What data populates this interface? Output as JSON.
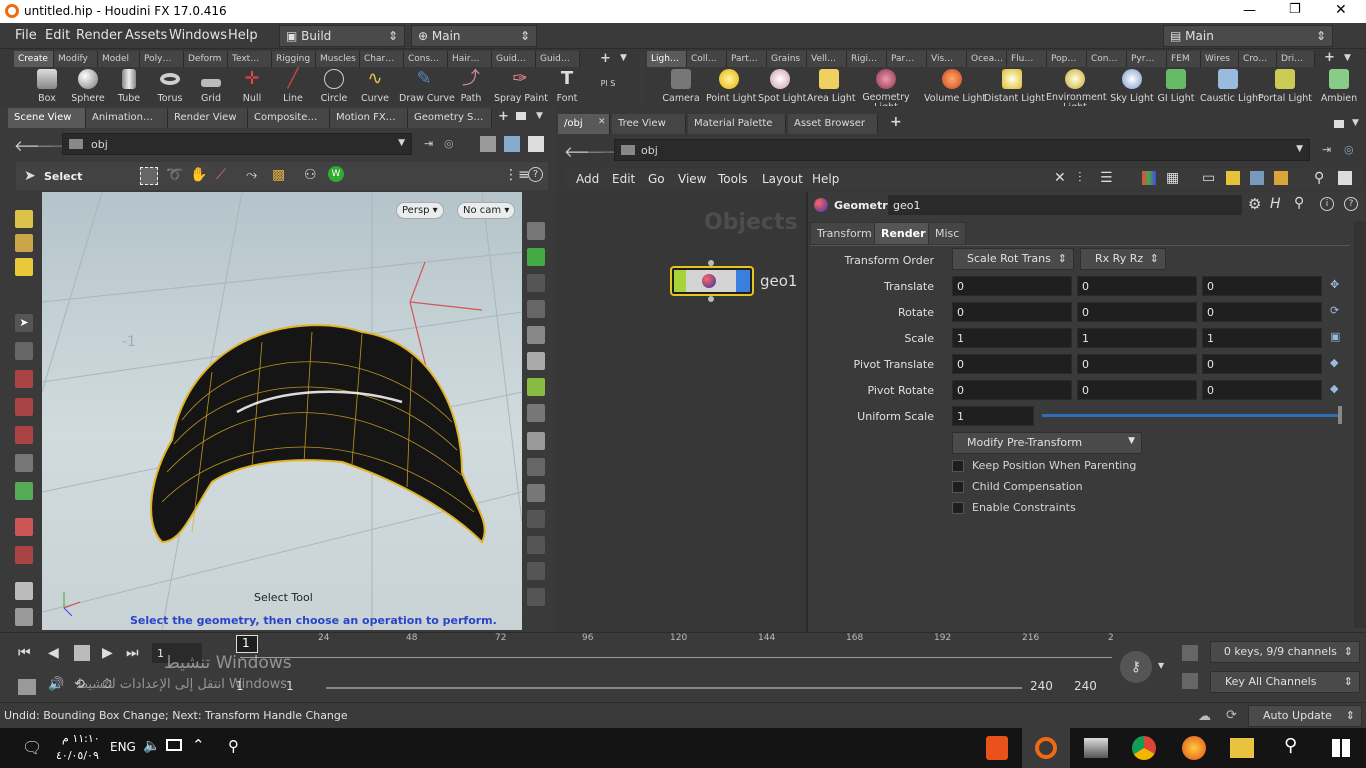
{
  "window": {
    "title": "untitled.hip - Houdini FX 17.0.416",
    "controls": [
      "—",
      "❐",
      "✕"
    ]
  },
  "menubar": {
    "items": [
      "File",
      "Edit",
      "Render",
      "Assets",
      "Windows",
      "Help"
    ],
    "desktop": "Build",
    "context": "Main",
    "right_context": "Main"
  },
  "shelf_left": {
    "tabs": [
      "Create",
      "Modify",
      "Model",
      "Poly…",
      "Deform",
      "Text…",
      "Rigging",
      "Muscles",
      "Char…",
      "Cons…",
      "Hair…",
      "Guid…",
      "Guid…"
    ],
    "tools": [
      "Box",
      "Sphere",
      "Tube",
      "Torus",
      "Grid",
      "Null",
      "Line",
      "Circle",
      "Curve",
      "Draw Curve",
      "Path",
      "Spray Paint",
      "Font",
      "Pl S"
    ]
  },
  "shelf_right": {
    "tabs": [
      "Ligh…",
      "Coll…",
      "Part…",
      "Grains",
      "Vell…",
      "Rigi…",
      "Par…",
      "Vis…",
      "Ocea…",
      "Flu…",
      "Pop…",
      "Con…",
      "Pyr…",
      "FEM",
      "Wires",
      "Cro…",
      "Dri…"
    ],
    "tools": [
      "Camera",
      "Point Light",
      "Spot Light",
      "Area Light",
      "Geometry Light",
      "Volume Light",
      "Distant Light",
      "Environment Light",
      "Sky Light",
      "GI Light",
      "Caustic Light",
      "Portal Light",
      "Ambien"
    ]
  },
  "left_pane": {
    "tabs": [
      "Scene View",
      "Animation…",
      "Render View",
      "Composite…",
      "Motion FX…",
      "Geometry S…"
    ],
    "path": "obj",
    "select_label": "Select",
    "persp": "Persp",
    "cam": "No cam",
    "axis_label": "-1",
    "tool_name": "Select Tool",
    "tool_hint": "Select the geometry, then choose an operation to perform."
  },
  "right_pane": {
    "tabs": [
      "/obj",
      "Tree View",
      "Material Palette",
      "Asset Browser"
    ],
    "path": "obj",
    "menu": [
      "Add",
      "Edit",
      "Go",
      "View",
      "Tools",
      "Layout",
      "Help"
    ],
    "network_label": "Objects",
    "node_name": "geo1"
  },
  "params": {
    "type": "Geometry",
    "name": "geo1",
    "tabs": [
      "Transform",
      "Render",
      "Misc"
    ],
    "transform_order_label": "Transform Order",
    "transform_order": "Scale Rot Trans",
    "rot_order": "Rx Ry Rz",
    "rows": [
      {
        "label": "Translate",
        "v": [
          "0",
          "0",
          "0"
        ]
      },
      {
        "label": "Rotate",
        "v": [
          "0",
          "0",
          "0"
        ]
      },
      {
        "label": "Scale",
        "v": [
          "1",
          "1",
          "1"
        ]
      },
      {
        "label": "Pivot Translate",
        "v": [
          "0",
          "0",
          "0"
        ]
      },
      {
        "label": "Pivot Rotate",
        "v": [
          "0",
          "0",
          "0"
        ]
      }
    ],
    "uniform_scale_label": "Uniform Scale",
    "uniform_scale": "1",
    "modify_pre": "Modify Pre-Transform",
    "checks": [
      "Keep Position When Parenting",
      "Child Compensation",
      "Enable Constraints"
    ]
  },
  "timeline": {
    "current_frame": "1",
    "frame_field": "1",
    "ticks": [
      "24",
      "48",
      "72",
      "96",
      "120",
      "144",
      "168",
      "192",
      "216",
      "2"
    ],
    "range_start": "1",
    "range_start2": "1",
    "range_end": "240",
    "range_end2": "240",
    "keys_info": "0 keys, 9/9 channels",
    "key_all": "Key All Channels",
    "watermark1": "تنشيط Windows",
    "watermark2": "انتقل إلى الإعدادات لتنشيط Windows"
  },
  "status": {
    "text": "Undid: Bounding Box Change; Next: Transform Handle Change",
    "auto_update": "Auto Update"
  },
  "taskbar": {
    "time": "١١:١٠ م",
    "date": "٤٠/٠٥/٠٩",
    "lang": "ENG"
  }
}
